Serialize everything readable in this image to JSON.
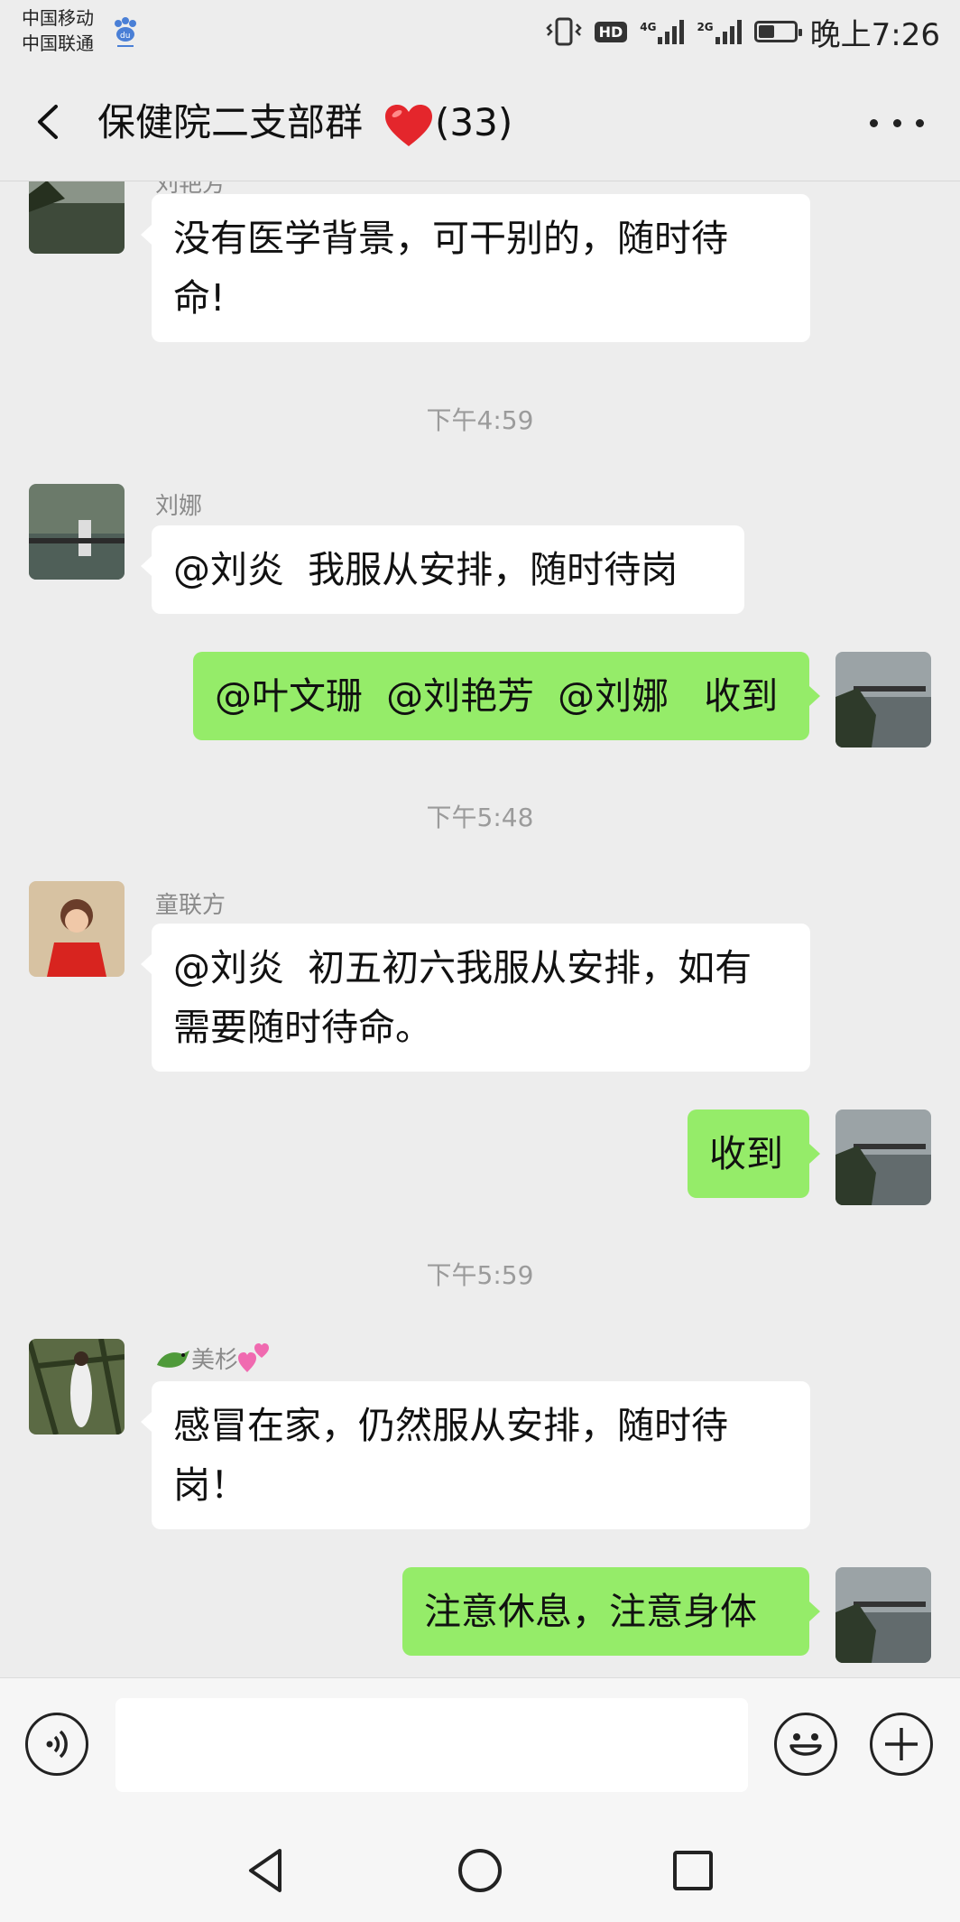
{
  "status_bar": {
    "carrier_1": "中国移动",
    "carrier_2": "中国联通",
    "network_1": "4G",
    "network_2": "2G",
    "hd_label": "HD",
    "time": "晚上7:26",
    "battery_level": 0.45
  },
  "header": {
    "title": "保健院二支部群",
    "member_count": "(33)"
  },
  "messages": [
    {
      "type": "in",
      "sender": "刘艳芳",
      "text": "没有医学背景，可干别的，随时待\n命!"
    },
    {
      "type": "time",
      "text": "下午4:59"
    },
    {
      "type": "in",
      "sender": "刘娜",
      "text": "@刘炎  我服从安排，随时待岗"
    },
    {
      "type": "out",
      "text": "@叶文珊  @刘艳芳  @刘娜   收到"
    },
    {
      "type": "time",
      "text": "下午5:48"
    },
    {
      "type": "in",
      "sender": "童联方",
      "text": "@刘炎  初五初六我服从安排，如有\n需要随时待命。"
    },
    {
      "type": "out",
      "text": "收到"
    },
    {
      "type": "time",
      "text": "下午5:59"
    },
    {
      "type": "in",
      "sender": "美杉",
      "text": "感冒在家，仍然服从安排，随时待\n岗！"
    },
    {
      "type": "out",
      "text": "注意休息，注意身体"
    }
  ],
  "input": {
    "value": "",
    "placeholder": ""
  },
  "colors": {
    "background": "#ededed",
    "bubble_out": "#95ec69",
    "bubble_in": "#ffffff"
  }
}
